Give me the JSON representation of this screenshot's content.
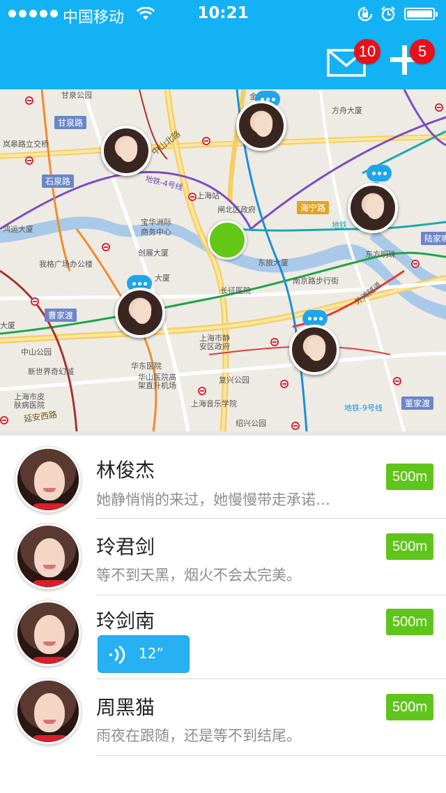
{
  "status_bar": {
    "carrier": "中国移动",
    "time": "10:21"
  },
  "header": {
    "mail_badge": "10",
    "add_badge": "5",
    "colors": {
      "bar": "#13b2f5",
      "badge": "#e8101a"
    }
  },
  "map": {
    "labels": [
      "甘泉公园",
      "方舟大厦",
      "金",
      "岚皋路立交桥",
      "上海站",
      "闸北区政府",
      "海宁路",
      "宝华洲际",
      "商务中心",
      "鸿运大厦",
      "创展大厦",
      "我格广场办公楼",
      "东旅大厦",
      "南京路步行街",
      "东方明珠",
      "陆家嘴",
      "大厦",
      "长征医院",
      "上海市静",
      "安区政府",
      "华东医院",
      "华山医院高",
      "架直升机场",
      "复兴公园",
      "上海音乐学院",
      "上海市皮",
      "肤病医院",
      "绍兴公园",
      "中山公园",
      "新世界奇幻城",
      "大厦",
      "地铁-4号线",
      "地铁-9号线",
      "外滩隧道",
      "地铁"
    ],
    "road_tags": [
      "甘泉路",
      "石泉路",
      "中山北路",
      "曹家渡",
      "延安西路",
      "董家渡"
    ],
    "colors": {
      "my_location": "#62c815",
      "chat_bubble": "#1fa6ea",
      "metro": "#d8242e"
    }
  },
  "contacts": [
    {
      "name": "林俊杰",
      "message": "她静悄悄的来过，她慢慢带走承诺…",
      "distance": "500m"
    },
    {
      "name": "玲君剑",
      "message": "等不到天黑，烟火不会太完美。",
      "distance": "500m"
    },
    {
      "name": "玲剑南",
      "voice_duration": "12”",
      "distance": "500m"
    },
    {
      "name": "周黑猫",
      "message": "雨夜在跟随，还是等不到结尾。",
      "distance": "500m"
    }
  ],
  "list_colors": {
    "distance_badge": "#5fc41c",
    "voice_bubble": "#27b1f2"
  }
}
